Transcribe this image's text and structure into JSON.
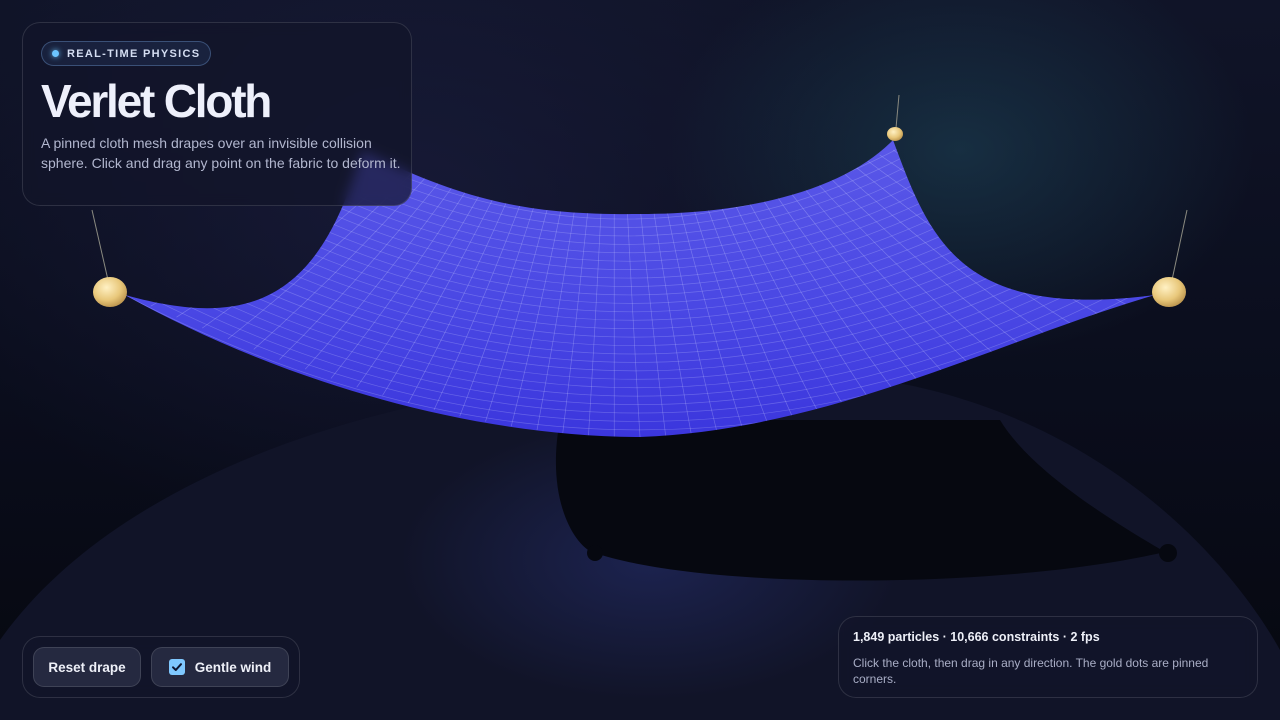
{
  "header": {
    "badge": "REAL-TIME PHYSICS",
    "title": "Verlet Cloth",
    "description": "A pinned cloth mesh drapes over an invisible collision sphere. Click and drag any point on the fabric to deform it."
  },
  "controls": {
    "reset_label": "Reset drape",
    "wind_label": "Gentle wind",
    "wind_checked": true
  },
  "stats": {
    "summary": "1,849 particles · 10,666 constraints · 2 fps",
    "hint": "Click the cloth, then drag in any direction. The gold dots are pinned corners."
  },
  "colors": {
    "cloth": "#4a45e6",
    "cloth_mesh": "#c9ccff",
    "pin": "#e8c77a",
    "accent": "#6cc6ff"
  }
}
